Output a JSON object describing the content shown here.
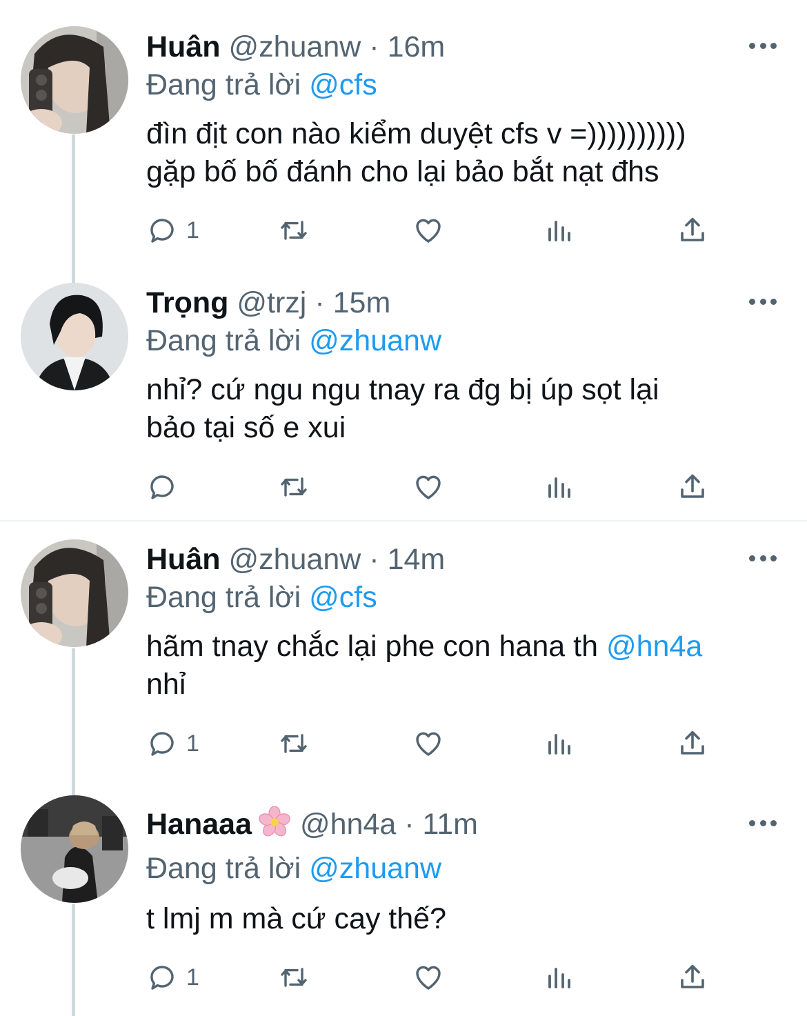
{
  "tweets": [
    {
      "name": "Huân",
      "handle": "@zhuanw",
      "sep": "·",
      "time": "16m",
      "reply_prefix": "Đang trả lời",
      "reply_to": "@cfs",
      "text_lines": [
        "đìn địt con nào kiểm duyệt cfs v =))))))))))",
        "gặp bố bố đánh cho lại bảo bắt nạt đhs"
      ],
      "reply_count": "1"
    },
    {
      "name": "Trọng",
      "handle": "@trzj",
      "sep": "·",
      "time": "15m",
      "reply_prefix": "Đang trả lời",
      "reply_to": "@zhuanw",
      "text_lines": [
        "nhỉ? cứ ngu ngu tnay ra đg bị úp sọt lại",
        "bảo tại số e xui"
      ],
      "reply_count": ""
    },
    {
      "name": "Huân",
      "handle": "@zhuanw",
      "sep": "·",
      "time": "14m",
      "reply_prefix": "Đang trả lời",
      "reply_to": "@cfs",
      "text_line1": "hãm tnay chắc lại phe con hana th ",
      "text_mention": "@hn4a",
      "text_line2": "nhỉ",
      "reply_count": "1"
    },
    {
      "name": "Hanaaa",
      "emoji": "cherry-blossom-emoji",
      "handle": "@hn4a",
      "sep": "·",
      "time": "11m",
      "reply_prefix": "Đang trả lời",
      "reply_to": "@zhuanw",
      "text_lines": [
        "t lmj m mà cứ cay thế?"
      ],
      "reply_count": "1"
    }
  ],
  "icons": [
    "reply-icon",
    "retweet-icon",
    "like-icon",
    "views-icon",
    "share-icon",
    "more-icon"
  ],
  "colors": {
    "accent": "#1d9bf0",
    "secondary_text": "#536471",
    "primary_text": "#0f1419",
    "thread_line": "#cfd9de"
  }
}
